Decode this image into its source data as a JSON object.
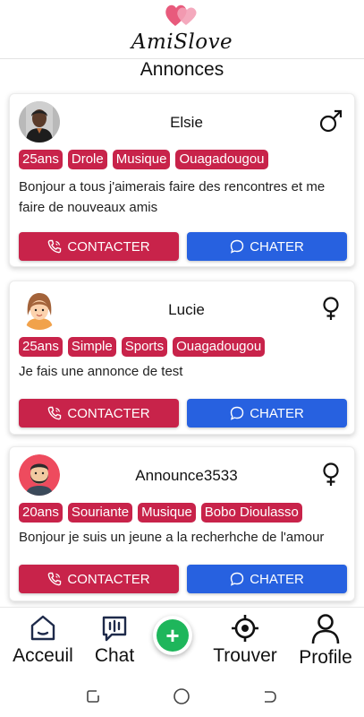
{
  "header": {
    "brand": "AmiSlove",
    "title": "Annonces"
  },
  "colors": {
    "accent": "#c8234a",
    "chat_blue": "#2761e0",
    "add_green": "#1eb65b"
  },
  "cards": [
    {
      "name": "Elsie",
      "gender": "male-symbol-icon",
      "tags": [
        "25ans",
        "Drole",
        "Musique",
        "Ouagadougou"
      ],
      "description": "Bonjour a tous j'aimerais faire des rencontres et me faire de nouveaux amis",
      "contact_label": "CONTACTER",
      "chat_label": "CHATER"
    },
    {
      "name": "Lucie",
      "gender": "female-symbol-icon",
      "tags": [
        "25ans",
        "Simple",
        "Sports",
        "Ouagadougou"
      ],
      "description": "Je fais une annonce de test",
      "contact_label": "CONTACTER",
      "chat_label": "CHATER"
    },
    {
      "name": "Announce3533",
      "gender": "female-symbol-icon",
      "tags": [
        "20ans",
        "Souriante",
        "Musique",
        "Bobo Dioulasso"
      ],
      "description": "Bonjour je suis un jeune a la recherhche de l'amour",
      "contact_label": "CONTACTER",
      "chat_label": "CHATER"
    }
  ],
  "nav": {
    "home": "Acceuil",
    "chat": "Chat",
    "add": "+",
    "find": "Trouver",
    "profile": "Profile"
  }
}
